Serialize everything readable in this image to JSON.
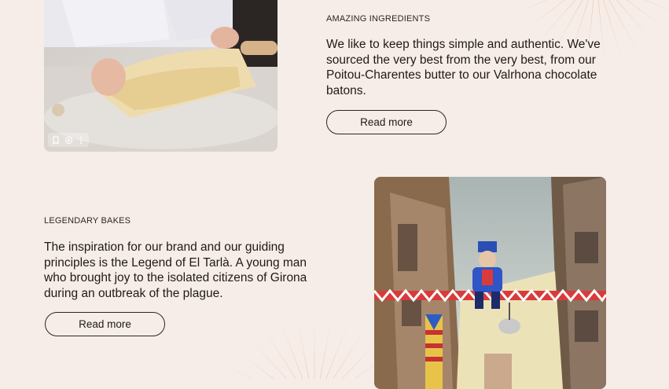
{
  "section_ingredients": {
    "eyebrow": "AMAZING INGREDIENTS",
    "body": "We like to keep things simple and authentic. We've sourced the very best from the very best, from our Poitou-Charentes butter to our Valrhona chocolate batons.",
    "button_label": "Read more",
    "image_icons": [
      "bookmark-icon",
      "lens-icon",
      "more-vertical-icon"
    ]
  },
  "section_legend": {
    "eyebrow": "LEGENDARY BAKES",
    "body": "The inspiration for our brand and our guiding principles is the Legend of El Tarlà. A young man who brought joy to the isolated citizens of Girona during an outbreak of the plague.",
    "button_label": "Read more"
  },
  "colors": {
    "background": "#f6ede8",
    "burst": "#f6b995",
    "text": "#1f1a17"
  }
}
